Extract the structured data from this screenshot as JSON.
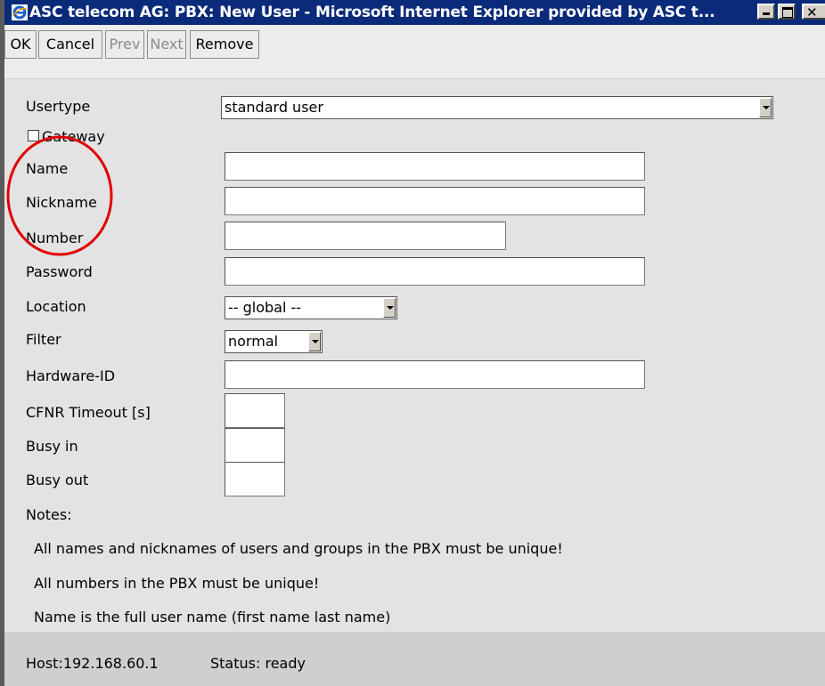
{
  "window": {
    "title": "ASC telecom AG: PBX: New User - Microsoft Internet Explorer provided by ASC t..."
  },
  "toolbar": {
    "ok_label": "OK",
    "cancel_label": "Cancel",
    "prev_label": "Prev",
    "next_label": "Next",
    "remove_label": "Remove"
  },
  "form": {
    "usertype": {
      "label": "Usertype",
      "value": "standard user"
    },
    "gateway": {
      "label": "Gateway",
      "checked": false
    },
    "name": {
      "label": "Name",
      "value": ""
    },
    "nickname": {
      "label": "Nickname",
      "value": ""
    },
    "number": {
      "label": "Number",
      "value": ""
    },
    "password": {
      "label": "Password",
      "value": ""
    },
    "location": {
      "label": "Location",
      "value": "-- global --"
    },
    "filter": {
      "label": "Filter",
      "value": "normal"
    },
    "hardware_id": {
      "label": "Hardware-ID",
      "value": ""
    },
    "cfnr_timeout": {
      "label": "CFNR Timeout [s]",
      "value": ""
    },
    "busy_in": {
      "label": "Busy in",
      "value": ""
    },
    "busy_out": {
      "label": "Busy out",
      "value": ""
    }
  },
  "notes": {
    "heading": "Notes:",
    "items": [
      "All names and nicknames of users and groups in the PBX  must be unique!",
      "All numbers in the PBX  must be unique!",
      "Name is the full user name (first name last name)"
    ]
  },
  "statusbar": {
    "host": "Host:192.168.60.1",
    "status": "Status: ready"
  },
  "colors": {
    "titlebar": "#0a2a7a",
    "annotation": "#e00000",
    "background": "#e3e3e3"
  }
}
